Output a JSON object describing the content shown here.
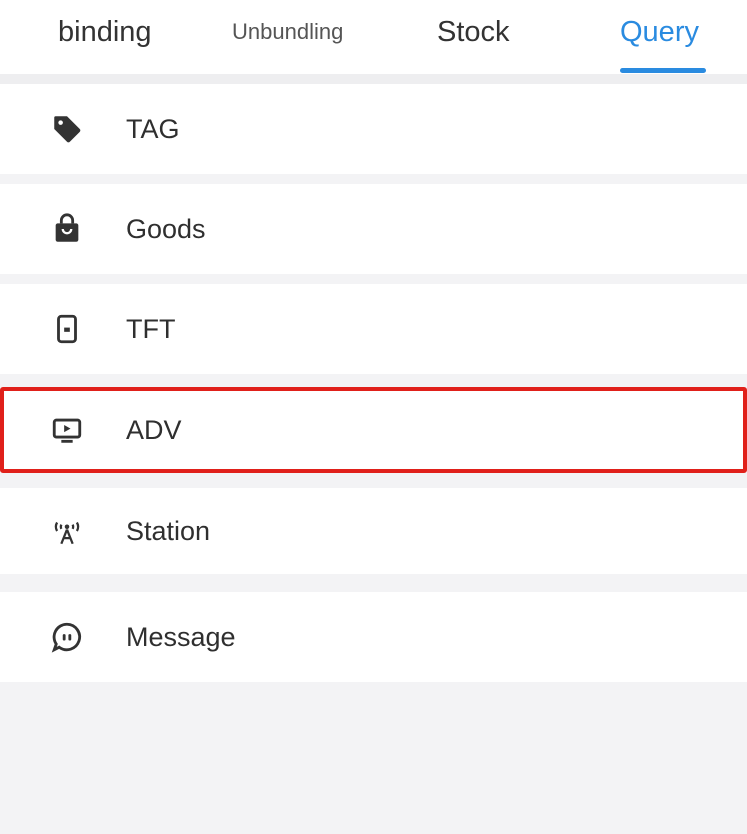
{
  "tabs": [
    {
      "label": "binding",
      "active": false
    },
    {
      "label": "Unbundling",
      "active": false
    },
    {
      "label": "Stock",
      "active": false
    },
    {
      "label": "Query",
      "active": true
    }
  ],
  "menu": [
    {
      "label": "TAG",
      "icon": "tag-icon"
    },
    {
      "label": "Goods",
      "icon": "shopping-bag-icon"
    },
    {
      "label": "TFT",
      "icon": "tablet-icon"
    },
    {
      "label": "ADV",
      "icon": "video-screen-icon",
      "highlighted": true
    },
    {
      "label": "Station",
      "icon": "antenna-icon"
    },
    {
      "label": "Message",
      "icon": "chat-bubble-icon"
    }
  ],
  "colors": {
    "accent": "#2a8be0",
    "highlight_border": "#e0201a",
    "background": "#f3f3f5"
  }
}
